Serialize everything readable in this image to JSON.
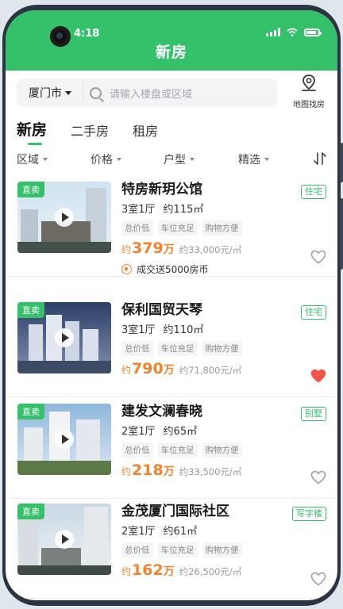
{
  "status_bar": {
    "time": "4:18"
  },
  "header": {
    "title": "新房"
  },
  "search": {
    "city": "厦门市",
    "placeholder": "请输入楼盘或区域",
    "map_label": "地图找房"
  },
  "tabs": [
    {
      "label": "新房",
      "active": true
    },
    {
      "label": "二手房",
      "active": false
    },
    {
      "label": "租房",
      "active": false
    }
  ],
  "filters": [
    {
      "label": "区域"
    },
    {
      "label": "价格"
    },
    {
      "label": "户型"
    },
    {
      "label": "精选"
    }
  ],
  "sort_icon": "sort-icon",
  "listings": [
    {
      "tag": "直卖",
      "name": "特房新玥公馆",
      "type": "住宅",
      "rooms": "3室1厅",
      "area": "约115㎡",
      "features": [
        "总价低",
        "车位充足",
        "购物方便"
      ],
      "price_prefix": "约",
      "price": "379",
      "price_unit": "万",
      "unit_price": "约33,000元/㎡",
      "promo": "成交送5000房币",
      "favorited": false
    },
    {
      "tag": "直卖",
      "name": "保利国贸天琴",
      "type": "住宅",
      "rooms": "3室1厅",
      "area": "约110㎡",
      "features": [
        "总价低",
        "车位充足",
        "购物方便"
      ],
      "price_prefix": "约",
      "price": "790",
      "price_unit": "万",
      "unit_price": "约71,800元/㎡",
      "favorited": true
    },
    {
      "tag": "直卖",
      "name": "建发文澜春晓",
      "type": "别墅",
      "rooms": "2室1厅",
      "area": "约65㎡",
      "features": [
        "总价低",
        "车位充足",
        "购物方便"
      ],
      "price_prefix": "约",
      "price": "218",
      "price_unit": "万",
      "unit_price": "约33,500元/㎡",
      "favorited": false
    },
    {
      "tag": "直卖",
      "name": "金茂厦门国际社区",
      "type": "写字楼",
      "rooms": "2室1厅",
      "area": "约61㎡",
      "features": [
        "总价低",
        "车位充足",
        "购物方便"
      ],
      "price_prefix": "约",
      "price": "162",
      "price_unit": "万",
      "unit_price": "约26,500元/㎡",
      "favorited": false
    }
  ],
  "colors": {
    "brand": "#34c16a",
    "price": "#f2832e",
    "favorite": "#f0554a"
  }
}
